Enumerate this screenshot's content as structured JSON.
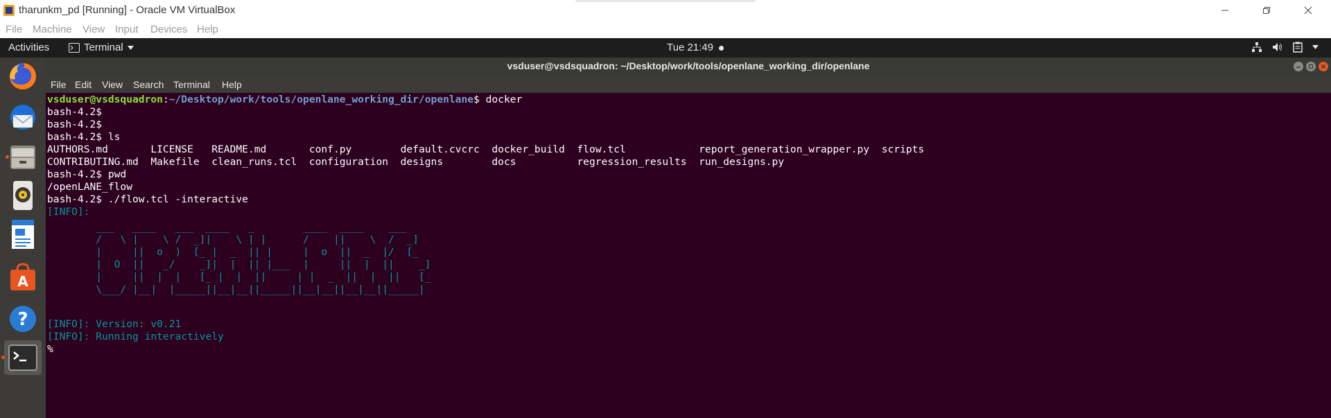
{
  "host_window": {
    "title": "tharunkm_pd [Running] - Oracle VM VirtualBox",
    "menu": [
      "File",
      "Machine",
      "View",
      "Input",
      "Devices",
      "Help"
    ]
  },
  "topbar": {
    "activities": "Activities",
    "app_menu": "Terminal",
    "clock": "Tue 21:49"
  },
  "dock": {
    "items": [
      "firefox-icon",
      "thunderbird-icon",
      "files-icon",
      "rhythmbox-icon",
      "libreoffice-writer-icon",
      "software-center-icon",
      "help-icon",
      "terminal-icon"
    ]
  },
  "terminal": {
    "title": "vsduser@vsdsquadron: ~/Desktop/work/tools/openlane_working_dir/openlane",
    "menu": [
      "File",
      "Edit",
      "View",
      "Search",
      "Terminal",
      "Help"
    ],
    "prompt_user": "vsduser@vsdsquadron",
    "prompt_path": "~/Desktop/work/tools/openlane_working_dir/openlane",
    "first_cmd": "$ docker",
    "lines": [
      "bash-4.2$",
      "bash-4.2$",
      "bash-4.2$ ls",
      "AUTHORS.md       LICENSE   README.md       conf.py        default.cvcrc  docker_build  flow.tcl            report_generation_wrapper.py  scripts",
      "CONTRIBUTING.md  Makefile  clean_runs.tcl  configuration  designs        docs          regression_results  run_designs.py",
      "bash-4.2$ pwd",
      "/openLANE_flow",
      "bash-4.2$ ./flow.tcl -interactive"
    ],
    "info_header": "[INFO]:",
    "ascii_art": [
      "        ___   ____   ___  ____   _        ____  ____    ___",
      "        /   \\ |    \\ /  _]|    \\ | |      /    ||    \\  /  _]",
      "        |     ||  o  )  [_ |  _  || |     |  o  ||  _  |/  [_",
      "        |  O  ||   _/    _]|  |  || |___  |     ||  |  ||    _]",
      "        |     ||  |  |   [_ |  |  ||     | |  _  ||  |  ||   [_",
      "        \\___/ |__|  |_____||__|__||_____||__|__||__|__||_____|"
    ],
    "info_version": "[INFO]: Version: v0.21",
    "info_running": "[INFO]: Running interactively",
    "tcl_prompt": "%"
  }
}
